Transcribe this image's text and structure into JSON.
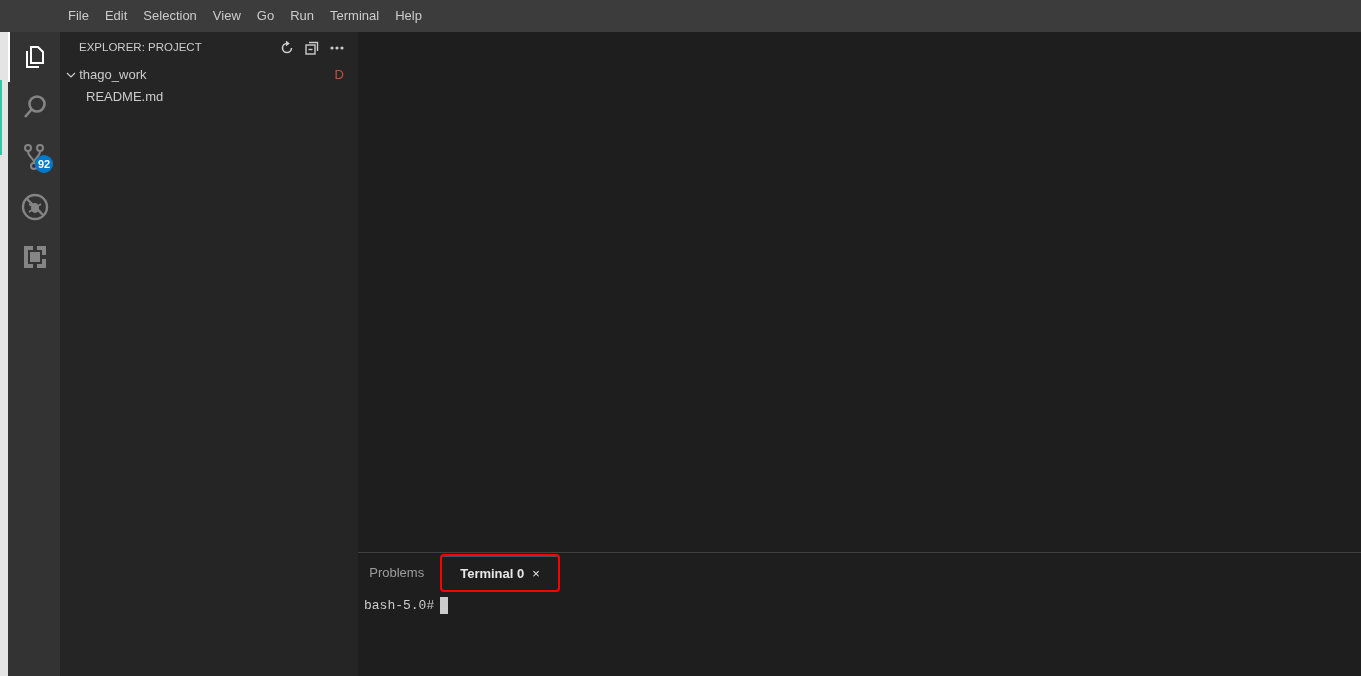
{
  "menu": [
    "File",
    "Edit",
    "Selection",
    "View",
    "Go",
    "Run",
    "Terminal",
    "Help"
  ],
  "activity_bar": [
    {
      "kind": "files",
      "selected": true
    },
    {
      "kind": "search",
      "selected": false
    },
    {
      "kind": "source-control",
      "selected": false,
      "badge": "92"
    },
    {
      "kind": "debug",
      "selected": false
    },
    {
      "kind": "extensions",
      "selected": false
    }
  ],
  "sidebar": {
    "title": "EXPLORER: PROJECT",
    "tree": [
      {
        "label": "thago_work",
        "expanded": true,
        "status": "D",
        "children": [
          {
            "label": "README.md"
          }
        ]
      }
    ]
  },
  "panel": {
    "tabs": [
      {
        "label": "Problems",
        "selected": false
      },
      {
        "label": "Terminal 0",
        "selected": true,
        "close": "×",
        "highlighted": true
      }
    ],
    "terminal": {
      "prompt": "bash-5.0#"
    }
  }
}
